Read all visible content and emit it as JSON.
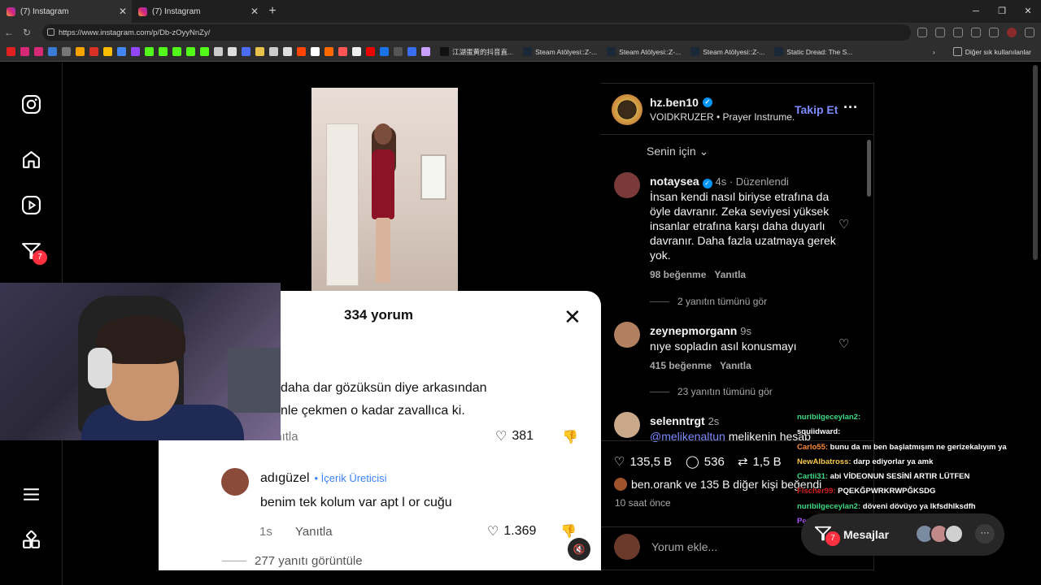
{
  "browser": {
    "tabs": [
      {
        "title": "(7) Instagram"
      },
      {
        "title": "(7) Instagram"
      }
    ],
    "url": "https://www.instagram.com/p/Db-zOyyNnZy/",
    "bookmarks": [
      "江湖蛋黄的抖音直...",
      "Steam Atölyesi::Z-...",
      "Steam Atölyesi::Z-...",
      "Steam Atölyesi::Z-...",
      "Static Dread: The S..."
    ],
    "bookmarks_other": "Diğer sık kullanılanlar"
  },
  "sidebar": {
    "notification_badge": "7",
    "icons": [
      "instagram-logo-icon",
      "home-icon",
      "reels-icon",
      "notifications-icon",
      "menu-icon",
      "apps-icon"
    ]
  },
  "popup": {
    "title": "334 yorum",
    "comment1_line1": "daha dar gözüksün diye arkasından",
    "comment1_line2": "nle çekmen o kadar zavallıca ki.",
    "reply1": "Yanıtla",
    "likes1": "381",
    "comment2_user": "adıgüzel",
    "comment2_badge": "• İçerik Üreticisi",
    "comment2_text": "benim tek kolum var apt  l or    cuğu",
    "comment2_time": "1s",
    "reply2": "Yanıtla",
    "likes2": "1.369",
    "more_replies": "277 yanıtı görüntüle"
  },
  "post": {
    "username": "hz.ben10",
    "subtitle": "VOIDKRUZER • Prayer Instrume...",
    "follow_label": "Takip Et",
    "sort_label": "Senin için",
    "comments": [
      {
        "user": "notaysea",
        "time": "4s · Düzenlendi",
        "text": "İnsan kendi nasıl biriyse etrafına da öyle davranır. Zeka seviyesi yüksek insanlar etrafına karşı daha duyarlı davranır. Daha fazla uzatmaya gerek yok.",
        "likes": "98 beğenme",
        "reply": "Yanıtla",
        "view_replies": "2 yanıtın tümünü gör"
      },
      {
        "user": "zeynepmorgann",
        "time": "9s",
        "text": "nıye sopladın asıl konusmayı",
        "likes": "415 beğenme",
        "reply": "Yanıtla",
        "view_replies": "23 yanıtın tümünü gör"
      },
      {
        "user": "selenntrgt",
        "time": "2s",
        "mention": "@melikenaltun",
        "text": "melikenin hesab"
      }
    ],
    "like_count": "135,5 B",
    "comment_count": "536",
    "repost_count": "1,5 B",
    "liked_by": "ben.orank ve 135 B diğer kişi beğendi",
    "posted_ago": "10 saat önce",
    "add_comment_placeholder": "Yorum ekle..."
  },
  "chat": [
    {
      "user": "nuribilgeceylan2:",
      "msg": "",
      "color": "#3ddc84"
    },
    {
      "user": "squiidward:",
      "msg": "",
      "color": "#ffffff"
    },
    {
      "user": "Carlo55:",
      "msg": "bunu da mı ben başlatmışım ne gerizekalıyım ya",
      "color": "#ff8c3a"
    },
    {
      "user": "NewAlbatross:",
      "msg": "darp ediyorlar ya amk",
      "color": "#f7c948"
    },
    {
      "user": "Cartii31:",
      "msg": "abi VİDEONUN SESİNİ ARTIR LÜTFEN",
      "color": "#3ddc84"
    },
    {
      "user": "Fischer99:",
      "msg": "PQEKĞPWRKRWPĞKSDG",
      "color": "#d61f1f"
    },
    {
      "user": "nuribilgeceylan2:",
      "msg": "döveni dövüyo ya lkfsdhlksdfh",
      "color": "#3ddc84"
    },
    {
      "user": "PepsiMan14:",
      "msg": "",
      "color": "#b455ff"
    }
  ],
  "messages": {
    "label": "Mesajlar",
    "badge": "7",
    "more": "···"
  },
  "colors": {
    "accent": "#0095f6",
    "follow": "#7c8cff",
    "badge": "#ff3040"
  }
}
